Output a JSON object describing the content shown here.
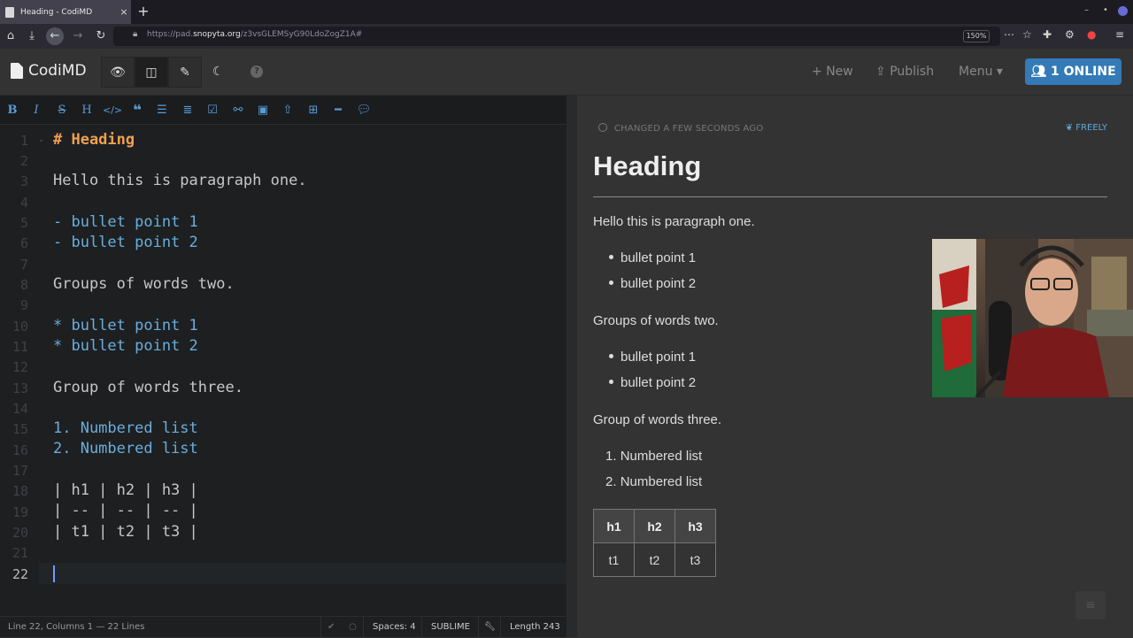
{
  "browser": {
    "tab_title": "Heading - CodiMD",
    "tab_close": "×",
    "new_tab": "+",
    "url_prefix": "https://pad.",
    "url_domain": "snopyta.org",
    "url_path": "/z3vsGLEMSyG90LdoZogZ1A#",
    "zoom": "150%",
    "win_min": "–",
    "win_max": "•"
  },
  "navbar": {
    "brand": "CodiMD",
    "new_label": "New",
    "publish_label": "Publish",
    "menu_label": "Menu",
    "online_label": "1 ONLINE",
    "help": "?"
  },
  "editor": {
    "line_numbers": [
      "1",
      "2",
      "3",
      "4",
      "5",
      "6",
      "7",
      "8",
      "9",
      "10",
      "11",
      "12",
      "13",
      "14",
      "15",
      "16",
      "17",
      "18",
      "19",
      "20",
      "21",
      "22"
    ],
    "lines": {
      "l1": "# Heading",
      "l3": "Hello this is paragraph one.",
      "l5": "- bullet point 1",
      "l6": "- bullet point 2",
      "l8": "Groups of words two.",
      "l10": "* bullet point 1",
      "l11": "* bullet point 2",
      "l13": "Group of words three.",
      "l15": "1. Numbered list",
      "l16": "2. Numbered list",
      "l18": "| h1 | h2 | h3 |",
      "l19": "| -- | -- | -- |",
      "l20": "| t1 | t2 | t3 |"
    }
  },
  "status": {
    "position": "Line 22, Columns 1 — 22 Lines",
    "spaces": "Spaces: 4",
    "keymap": "SUBLIME",
    "length": "Length 243"
  },
  "preview": {
    "changed": "CHANGED A FEW SECONDS AGO",
    "permission": "FREELY",
    "h1": "Heading",
    "p1": "Hello this is paragraph one.",
    "list1": [
      "bullet point 1",
      "bullet point 2"
    ],
    "p2": "Groups of words two.",
    "list2": [
      "bullet point 1",
      "bullet point 2"
    ],
    "p3": "Group of words three.",
    "olist": [
      "Numbered list",
      "Numbered list"
    ],
    "olist_markers": [
      "1.",
      "2."
    ],
    "table": {
      "headers": [
        "h1",
        "h2",
        "h3"
      ],
      "row": [
        "t1",
        "t2",
        "t3"
      ]
    }
  },
  "colors": {
    "accent": "#337ab7",
    "heading_syntax": "#f0a050",
    "list_syntax": "#6aaedc"
  }
}
